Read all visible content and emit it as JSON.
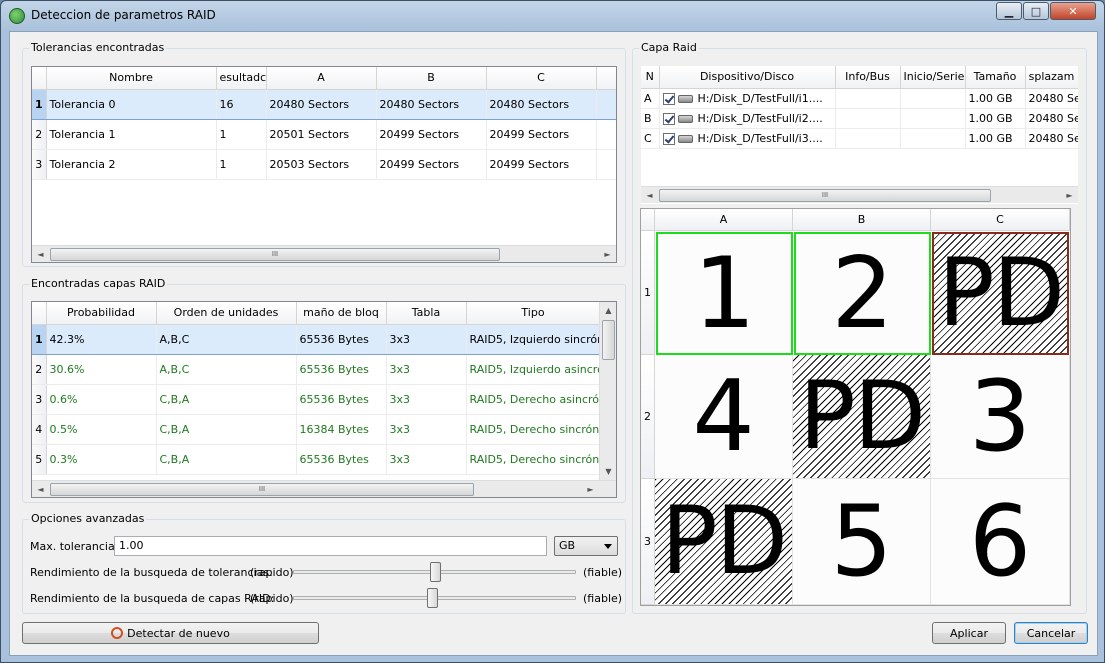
{
  "window": {
    "title": "Deteccion de parametros RAID",
    "minimize": "▁",
    "maximize": "□",
    "close": "✕"
  },
  "tolerances": {
    "group_title": "Tolerancias encontradas",
    "columns": [
      "",
      "Nombre",
      "esultadc",
      "A",
      "B",
      "C"
    ],
    "rows": [
      {
        "n": "1",
        "nombre": "Tolerancia 0",
        "res": "16",
        "a": "20480 Sectors",
        "b": "20480 Sectors",
        "c": "20480 Sectors"
      },
      {
        "n": "2",
        "nombre": "Tolerancia 1",
        "res": "1",
        "a": "20501 Sectors",
        "b": "20499 Sectors",
        "c": "20499 Sectors"
      },
      {
        "n": "3",
        "nombre": "Tolerancia 2",
        "res": "1",
        "a": "20503 Sectors",
        "b": "20499 Sectors",
        "c": "20499 Sectors"
      }
    ]
  },
  "layers": {
    "group_title": "Encontradas capas RAID",
    "columns": [
      "",
      "Probabilidad",
      "Orden de unidades",
      "maño de bloq",
      "Tabla",
      "Tipo"
    ],
    "rows": [
      {
        "n": "1",
        "prob": "42.3%",
        "orden": "A,B,C",
        "bloque": "65536 Bytes",
        "tabla": "3x3",
        "tipo": "RAID5, Izquierdo sincrón"
      },
      {
        "n": "2",
        "prob": "30.6%",
        "orden": "A,B,C",
        "bloque": "65536 Bytes",
        "tabla": "3x3",
        "tipo": "RAID5, Izquierdo asincró"
      },
      {
        "n": "3",
        "prob": "0.6%",
        "orden": "C,B,A",
        "bloque": "65536 Bytes",
        "tabla": "3x3",
        "tipo": "RAID5, Derecho asincrón"
      },
      {
        "n": "4",
        "prob": "0.5%",
        "orden": "C,B,A",
        "bloque": "16384 Bytes",
        "tabla": "3x3",
        "tipo": "RAID5, Derecho sincróni"
      },
      {
        "n": "5",
        "prob": "0.3%",
        "orden": "C,B,A",
        "bloque": "65536 Bytes",
        "tabla": "3x3",
        "tipo": "RAID5, Derecho sincróni"
      }
    ]
  },
  "advanced": {
    "group_title": "Opciones avanzadas",
    "max_tol_label": "Max. tolerancia:",
    "max_tol_value": "1.00",
    "unit": "GB",
    "tol_perf_label": "Rendimiento de la busqueda de tolerancias:",
    "layer_perf_label": "Rendimiento de la busqueda de capas RAID:",
    "fast": "(rapido)",
    "reliable": "(fiable)",
    "tol_slider_level": 0.5,
    "layer_slider_level": 0.49
  },
  "capa": {
    "group_title": "Capa Raid",
    "columns": [
      "N",
      "Dispositivo/Disco",
      "Info/Bus",
      "Inicio/Serie",
      "Tamaño",
      "splazam"
    ],
    "rows": [
      {
        "n": "A",
        "disk": "H:/Disk_D/TestFull/i1....",
        "info": "",
        "inicio": "",
        "size": "1.00 GB",
        "offset": "20480 Se"
      },
      {
        "n": "B",
        "disk": "H:/Disk_D/TestFull/i2....",
        "info": "",
        "inicio": "",
        "size": "1.00 GB",
        "offset": "20480 Se"
      },
      {
        "n": "C",
        "disk": "H:/Disk_D/TestFull/i3....",
        "info": "",
        "inicio": "",
        "size": "1.00 GB",
        "offset": "20480 Se"
      }
    ]
  },
  "map": {
    "col_headers": [
      "A",
      "B",
      "C"
    ],
    "row_headers": [
      "1",
      "2",
      "3"
    ],
    "cells": [
      [
        "1",
        "2",
        "PD"
      ],
      [
        "4",
        "PD",
        "3"
      ],
      [
        "PD",
        "5",
        "6"
      ]
    ],
    "colors": {
      "first_stripe_border": "#1cdc1c",
      "parity_highlight_border": "#8a2a1a"
    }
  },
  "buttons": {
    "redetect": "Detectar de nuevo",
    "apply": "Aplicar",
    "cancel": "Cancelar"
  },
  "scroll": {
    "thumb": "III"
  }
}
